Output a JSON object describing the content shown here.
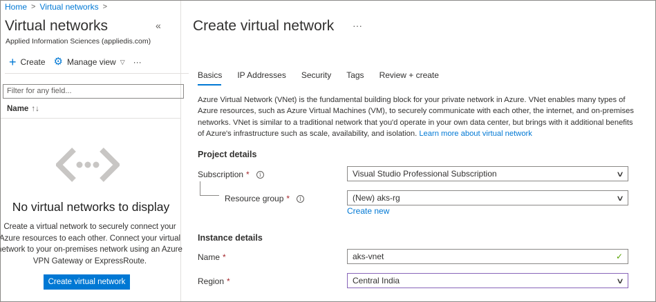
{
  "breadcrumb": {
    "home": "Home",
    "separator": ">",
    "current": "Virtual networks",
    "trailing": ">"
  },
  "left_pane": {
    "title": "Virtual networks",
    "collapse_glyph": "«",
    "subtitle": "Applied Information Sciences (appliedis.com)",
    "commands": {
      "create_icon": "plus-icon",
      "create_label": "Create",
      "manage_icon": "gear-icon",
      "manage_label": "Manage view",
      "manage_chevron": "chevron-down-icon",
      "more_glyph": "···"
    },
    "filter_placeholder": "Filter for any field...",
    "column_header": "Name",
    "sort_glyph": "↑↓",
    "empty_icon": "virtual-network-icon",
    "empty_title": "No virtual networks to display",
    "empty_description": "Create a virtual network to securely connect your Azure resources to each other. Connect your virtual network to your on-premises network using an Azure VPN Gateway or ExpressRoute.",
    "create_button": "Create virtual network"
  },
  "right_pane": {
    "title": "Create virtual network",
    "more_glyph": "···",
    "tabs": [
      {
        "label": "Basics",
        "selected": true
      },
      {
        "label": "IP Addresses",
        "selected": false
      },
      {
        "label": "Security",
        "selected": false
      },
      {
        "label": "Tags",
        "selected": false
      },
      {
        "label": "Review + create",
        "selected": false
      }
    ],
    "intro_text": "Azure Virtual Network (VNet) is the fundamental building block for your private network in Azure. VNet enables many types of Azure resources, such as Azure Virtual Machines (VM), to securely communicate with each other, the internet, and on-premises networks. VNet is similar to a traditional network that you'd operate in your own data center, but brings with it additional benefits of Azure's infrastructure such as scale, availability, and isolation.",
    "intro_link": "Learn more about virtual network",
    "project_details": {
      "heading": "Project details",
      "subscription_label": "Subscription",
      "subscription_value": "Visual Studio Professional Subscription",
      "resource_group_label": "Resource group",
      "resource_group_value": "(New) aks-rg",
      "create_new_link": "Create new"
    },
    "instance_details": {
      "heading": "Instance details",
      "name_label": "Name",
      "name_value": "aks-vnet",
      "region_label": "Region",
      "region_value": "Central India"
    },
    "required_marker": "*",
    "info_glyph": "i"
  },
  "colors": {
    "accent": "#0078d4",
    "required": "#a4262c",
    "valid": "#57a300",
    "focus_border": "#8764b8"
  }
}
